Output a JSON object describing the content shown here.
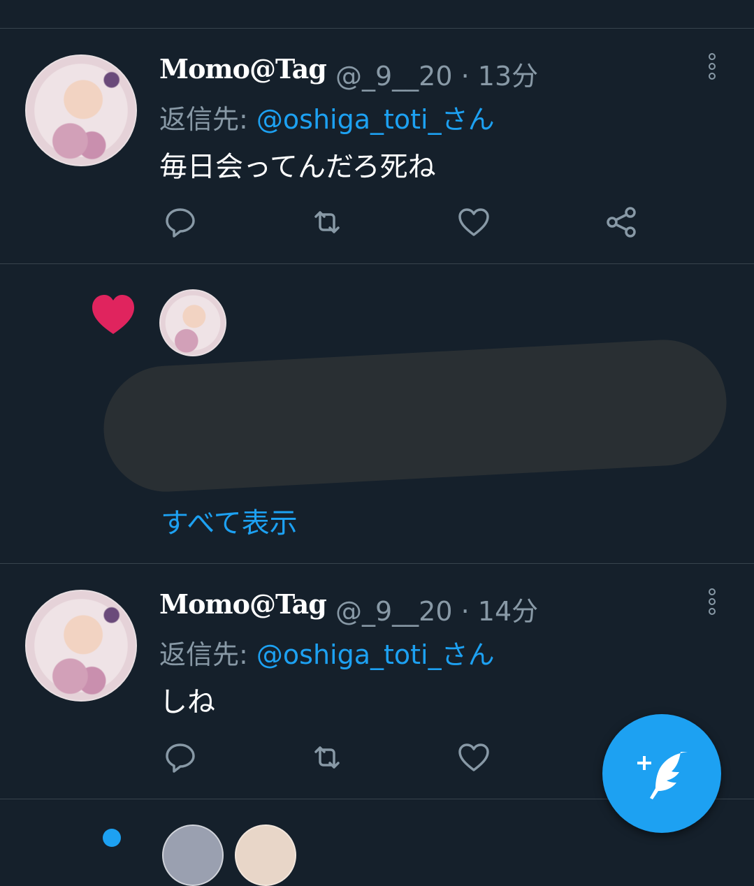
{
  "tweets": [
    {
      "name": "Momo@Tag",
      "meta": "@_9__20 · 13分",
      "reply_prefix": "返信先: ",
      "reply_mention": "@oshiga_toti_さん",
      "text": "毎日会ってんだろ死ね"
    },
    {
      "name": "Momo@Tag",
      "meta": "@_9__20 · 14分",
      "reply_prefix": "返信先: ",
      "reply_mention": "@oshiga_toti_さん",
      "text": "しね"
    }
  ],
  "liked_section": {
    "show_all": "すべて表示"
  },
  "colors": {
    "background": "#15202b",
    "accent": "#1da1f2",
    "secondary_text": "#8899a6",
    "like": "#e0245e"
  },
  "icons": [
    "reply-icon",
    "retweet-icon",
    "like-icon",
    "share-icon",
    "more-icon",
    "compose-icon",
    "liked-heart-icon"
  ]
}
